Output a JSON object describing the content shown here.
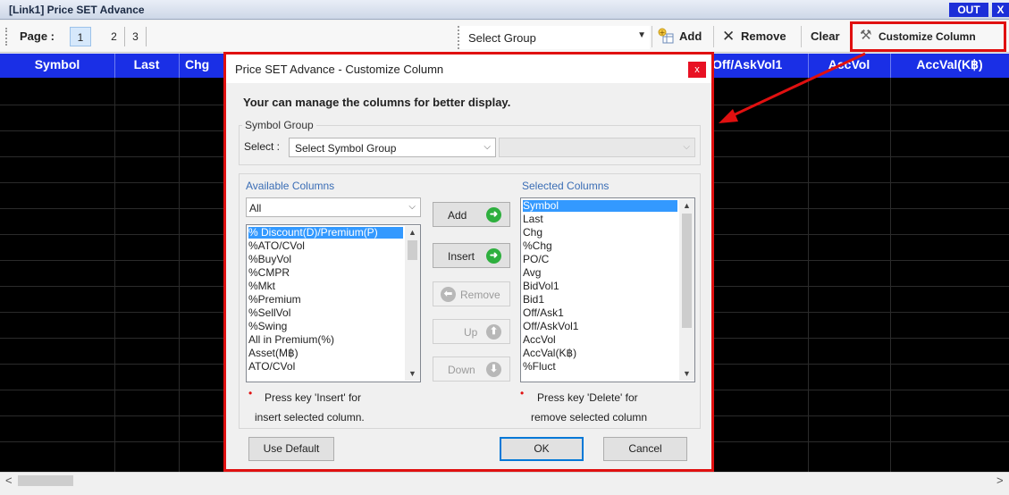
{
  "window": {
    "title": "[Link1] Price SET Advance",
    "out_label": "OUT",
    "close_label": "X"
  },
  "toolbar": {
    "page_label": "Page :",
    "pages": [
      "1",
      "2",
      "3"
    ],
    "group_select": "Select Group",
    "add_label": "Add",
    "remove_label": "Remove",
    "clear_label": "Clear",
    "customize_label": "Customize Column"
  },
  "grid": {
    "columns": [
      "Symbol",
      "Last",
      "Chg",
      "Off/AskVol1",
      "AccVol",
      "AccVal(K฿)"
    ]
  },
  "dialog": {
    "title": "Price SET Advance - Customize Column",
    "close_glyph": "x",
    "intro": "Your can manage the columns for better display.",
    "symbol_group": {
      "legend": "Symbol Group",
      "select_label": "Select :",
      "select_value": "Select Symbol Group"
    },
    "available": {
      "legend": "Available Columns",
      "filter": "All",
      "items": [
        "% Discount(D)/Premium(P)",
        "%ATO/CVol",
        "%BuyVol",
        "%CMPR",
        "%Mkt",
        "%Premium",
        "%SellVol",
        "%Swing",
        "All in Premium(%)",
        "Asset(M฿)",
        "ATO/CVol"
      ],
      "hint_line1": "Press key 'Insert' for",
      "hint_line2": "insert selected column."
    },
    "buttons": {
      "add": "Add",
      "insert": "Insert",
      "remove": "Remove",
      "up": "Up",
      "down": "Down"
    },
    "selected": {
      "legend": "Selected Columns",
      "items": [
        "Symbol",
        "Last",
        "Chg",
        "%Chg",
        "PO/C",
        "Avg",
        "BidVol1",
        "Bid1",
        "Off/Ask1",
        "Off/AskVol1",
        "AccVol",
        "AccVal(K฿)",
        "%Fluct"
      ],
      "hint_line1": "Press key 'Delete' for",
      "hint_line2": "remove selected column"
    },
    "footer": {
      "use_default": "Use Default",
      "ok": "OK",
      "cancel": "Cancel"
    }
  },
  "colors": {
    "header_blue": "#1a2fe6",
    "highlight_red": "#e01010",
    "selection_blue": "#3399ff"
  },
  "icons": {
    "add": "add-column-icon",
    "remove": "x-icon",
    "customize": "tools-icon"
  }
}
